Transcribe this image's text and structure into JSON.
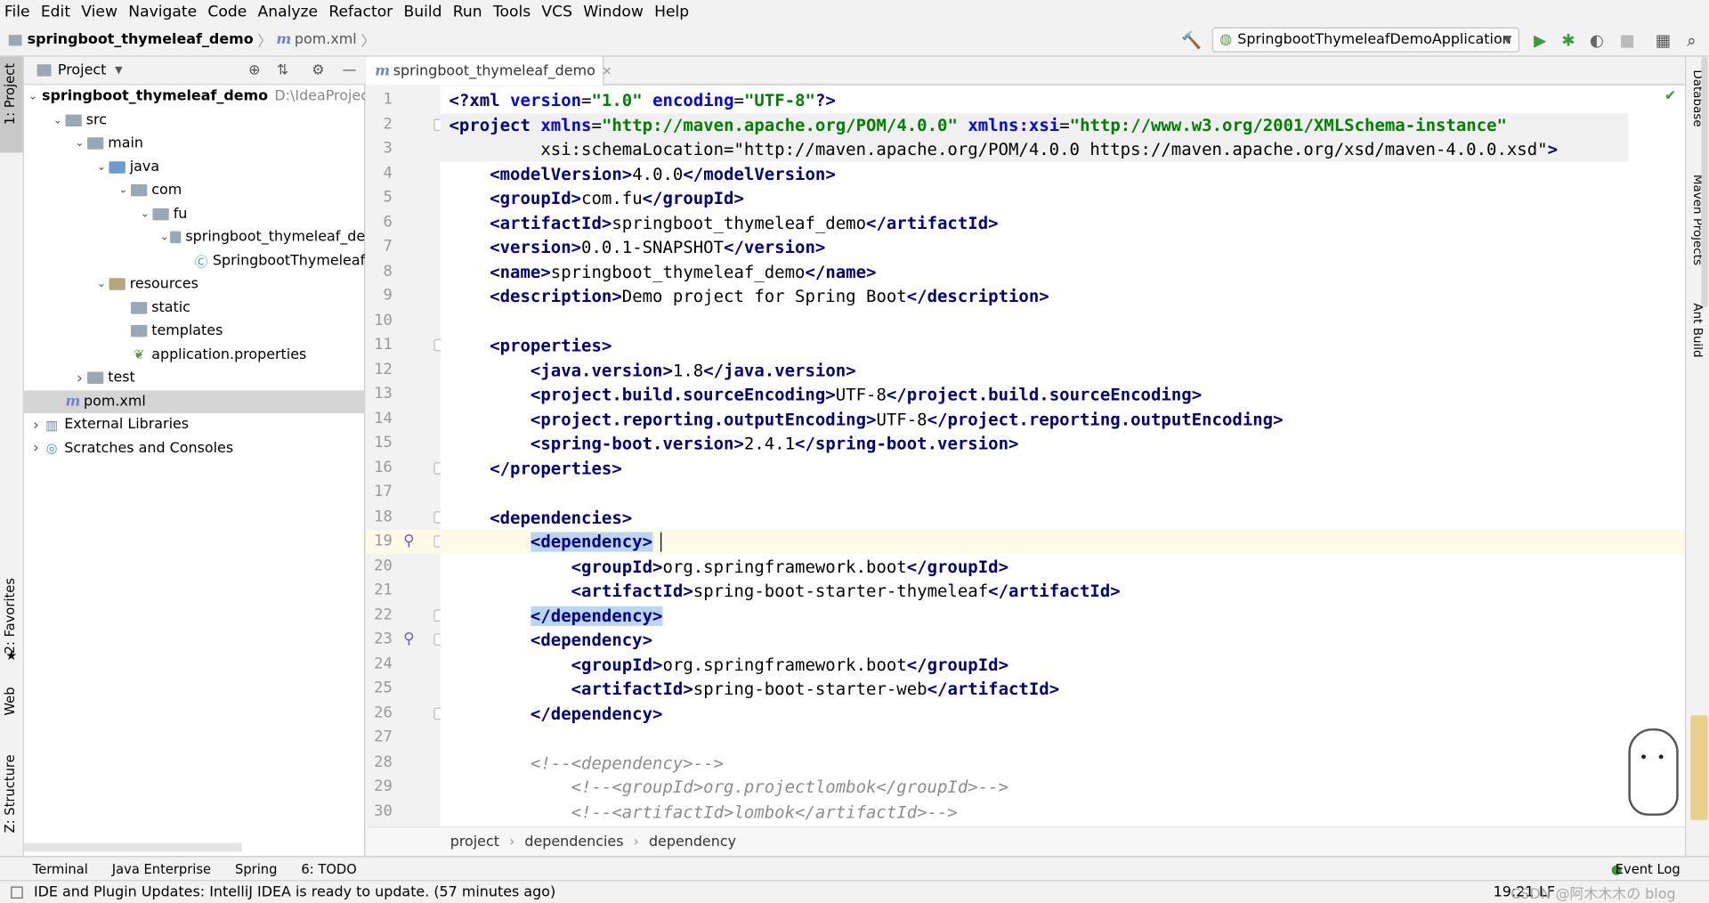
{
  "menu": [
    "File",
    "Edit",
    "View",
    "Navigate",
    "Code",
    "Analyze",
    "Refactor",
    "Build",
    "Run",
    "Tools",
    "VCS",
    "Window",
    "Help"
  ],
  "nav": {
    "project": "springboot_thymeleaf_demo",
    "file": "pom.xml",
    "run_config": "SpringbootThymeleafDemoApplication"
  },
  "left_tabs": {
    "project": "1: Project",
    "favorites": "2: Favorites",
    "web": "Web",
    "structure": "Z: Structure"
  },
  "right_tabs": {
    "database": "Database",
    "maven": "Maven Projects",
    "ant": "Ant Build"
  },
  "project_panel": {
    "title": "Project",
    "tree": [
      {
        "label": "springboot_thymeleaf_demo",
        "path": "D:\\IdeaProject\\",
        "depth": 0,
        "arrow": "open",
        "icon": "folder"
      },
      {
        "label": "src",
        "depth": 1,
        "arrow": "open",
        "icon": "folder"
      },
      {
        "label": "main",
        "depth": 2,
        "arrow": "open",
        "icon": "folder"
      },
      {
        "label": "java",
        "depth": 3,
        "arrow": "open",
        "icon": "folder-blue"
      },
      {
        "label": "com",
        "depth": 4,
        "arrow": "open",
        "icon": "folder"
      },
      {
        "label": "fu",
        "depth": 5,
        "arrow": "open",
        "icon": "folder"
      },
      {
        "label": "springboot_thymeleaf_de",
        "depth": 6,
        "arrow": "open",
        "icon": "folder"
      },
      {
        "label": "SpringbootThymeleaf",
        "depth": 7,
        "arrow": "",
        "icon": "class"
      },
      {
        "label": "resources",
        "depth": 3,
        "arrow": "open",
        "icon": "folder-res"
      },
      {
        "label": "static",
        "depth": 4,
        "arrow": "",
        "icon": "folder"
      },
      {
        "label": "templates",
        "depth": 4,
        "arrow": "",
        "icon": "folder"
      },
      {
        "label": "application.properties",
        "depth": 4,
        "arrow": "",
        "icon": "leaf"
      },
      {
        "label": "test",
        "depth": 2,
        "arrow": "closed",
        "icon": "folder"
      },
      {
        "label": "pom.xml",
        "depth": 1,
        "arrow": "",
        "icon": "maven",
        "selected": true
      },
      {
        "label": "External Libraries",
        "depth": 0,
        "arrow": "closed",
        "icon": "libs"
      },
      {
        "label": "Scratches and Consoles",
        "depth": 0,
        "arrow": "closed",
        "icon": "scratch"
      }
    ]
  },
  "editor": {
    "tab": "springboot_thymeleaf_demo",
    "current_line": 19,
    "lines": [
      "<?xml version=\"1.0\" encoding=\"UTF-8\"?>",
      "<project xmlns=\"http://maven.apache.org/POM/4.0.0\" xmlns:xsi=\"http://www.w3.org/2001/XMLSchema-instance\"",
      "         xsi:schemaLocation=\"http://maven.apache.org/POM/4.0.0 https://maven.apache.org/xsd/maven-4.0.0.xsd\">",
      "    <modelVersion>4.0.0</modelVersion>",
      "    <groupId>com.fu</groupId>",
      "    <artifactId>springboot_thymeleaf_demo</artifactId>",
      "    <version>0.0.1-SNAPSHOT</version>",
      "    <name>springboot_thymeleaf_demo</name>",
      "    <description>Demo project for Spring Boot</description>",
      "",
      "    <properties>",
      "        <java.version>1.8</java.version>",
      "        <project.build.sourceEncoding>UTF-8</project.build.sourceEncoding>",
      "        <project.reporting.outputEncoding>UTF-8</project.reporting.outputEncoding>",
      "        <spring-boot.version>2.4.1</spring-boot.version>",
      "    </properties>",
      "",
      "    <dependencies>",
      "        <dependency>",
      "            <groupId>org.springframework.boot</groupId>",
      "            <artifactId>spring-boot-starter-thymeleaf</artifactId>",
      "        </dependency>",
      "        <dependency>",
      "            <groupId>org.springframework.boot</groupId>",
      "            <artifactId>spring-boot-starter-web</artifactId>",
      "        </dependency>",
      "",
      "        <!--<dependency>-->",
      "            <!--<groupId>org.projectlombok</groupId>-->",
      "            <!--<artifactId>lombok</artifactId>-->"
    ]
  },
  "breadcrumb": [
    "project",
    "dependencies",
    "dependency"
  ],
  "bottom_tabs": [
    "Terminal",
    "Java Enterprise",
    "Spring",
    "6: TODO"
  ],
  "event_log": "Event Log",
  "status": {
    "message": "IDE and Plugin Updates: IntelliJ IDEA is ready to update. (57 minutes ago)",
    "position": "19:21",
    "line_sep": "LF"
  },
  "watermark": "CSDN @阿木木木の blog"
}
